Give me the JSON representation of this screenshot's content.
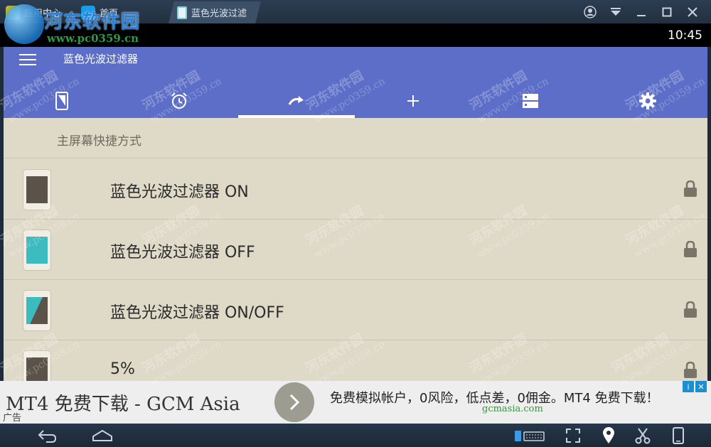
{
  "titlebar": {
    "tabs": [
      {
        "label": "应用中心"
      },
      {
        "label": "首页"
      },
      {
        "label": "蓝色光波过滤"
      }
    ]
  },
  "watermark": {
    "site": "河东软件园",
    "url": "www.pc0359.cn"
  },
  "statusbar": {
    "time": "10:45"
  },
  "app": {
    "title": "蓝色光波过滤器",
    "tabs": [
      {
        "icon": "phone-filter-icon"
      },
      {
        "icon": "alarm-clock-icon"
      },
      {
        "icon": "redo-arrow-icon",
        "active": true
      },
      {
        "icon": "plus-icon"
      },
      {
        "icon": "server-list-icon"
      },
      {
        "icon": "gear-icon"
      }
    ]
  },
  "list": {
    "section_header": "主屏幕快捷方式",
    "items": [
      {
        "label": "蓝色光波过滤器 ON",
        "screen": "dark"
      },
      {
        "label": "蓝色光波过滤器 OFF",
        "screen": "teal"
      },
      {
        "label": "蓝色光波过滤器 ON/OFF",
        "screen": "split"
      },
      {
        "label": "5%",
        "screen": "dark"
      }
    ]
  },
  "ad": {
    "headline": "MT4 免费下载  -  GCM Asia",
    "tag": "广告",
    "description": "免费模拟帐户，0风险，低点差，0佣金。MT4 免费下载！",
    "domain": "gcmasia.com"
  },
  "colors": {
    "appbar": "#5c6ec7",
    "list_bg": "#dfd9c8",
    "teal": "#3cbcc0",
    "dark_screen": "#5b5349"
  }
}
